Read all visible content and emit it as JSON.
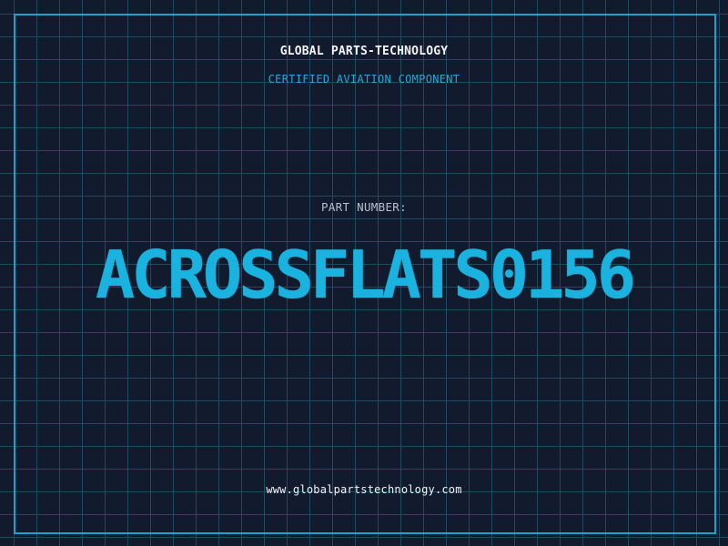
{
  "header": {
    "company": "GLOBAL PARTS-TECHNOLOGY",
    "subtitle": "CERTIFIED AVIATION COMPONENT"
  },
  "part": {
    "label": "PART NUMBER:",
    "number": "ACROSSFLATS0156"
  },
  "footer": {
    "website": "www.globalpartstechnology.com"
  },
  "colors": {
    "background": "#121a2e",
    "grid": "#1f4a5f",
    "frame": "#1aa3cc",
    "accent": "#1ab3e0",
    "text": "#f2f4f8",
    "muted": "#b7c0cc"
  }
}
